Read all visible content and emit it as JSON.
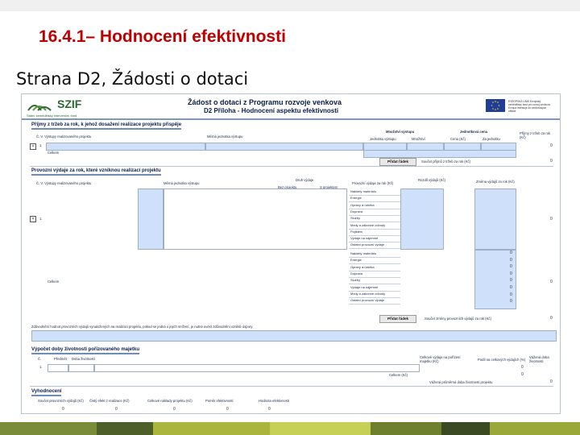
{
  "slide": {
    "title": "16.4.1– Hodnocení efektivnosti",
    "subtitle": "Strana D2, Žádosti o dotaci"
  },
  "form": {
    "logo_text": "SZIF",
    "logo_subtext": "Státní zemědělský intervenční fond",
    "title": "Žádost o dotaci z Programu rozvoje venkova",
    "subtitle": "D2 Příloha - Hodnocení aspektu efektivnosti",
    "eu_text": "EVROPSKÁ UNIE Evropský zemědělský fond pro rozvoj venkova: Evropa investuje do venkovských oblastí",
    "section1": {
      "heading": "Příjmy z tržeb za rok, k jehož dosažení realizace projektu přispěje",
      "col_item": "Č.  V. Výstupy realizovaného projektu",
      "col_measure": "Měrná jednotka výstupu",
      "col_amount": "Množství výstupu",
      "col_price": "Jednotková cena",
      "sub_unit": "Jednotka výstupu",
      "sub_qty": "Množství",
      "sub_unitprice": "Cena (Kč)",
      "sub_per": "Za jednotku",
      "col_revenue": "Příjmy z tržeb za rok (Kč)",
      "row_no": "1.",
      "total_label": "Celkem",
      "button": "Přidat řádek",
      "sum_label": "Součet příjmů z tržeb za rok (Kč)",
      "zero": "0"
    },
    "section2": {
      "heading": "Provozní výdaje za rok, které vzniknou realizací projektu",
      "col_item": "Č.  V. Výstupy realizovaného projektu",
      "col_measure": "Měrná jednotka výstupu",
      "col_kind": "Druh výdaje",
      "col_amount": "Provozní výdaje za rok (Kč)",
      "col_without": "Bez projektu",
      "col_with": "S projektem",
      "col_diff": "Rozdíl výdajů (Kč)",
      "col_change": "Změna výdajů za rok (Kč)",
      "row_no": "1.",
      "total_label": "Celkem",
      "costs": [
        "Náklady materiálu",
        "Energie",
        "Opravy a údržba",
        "Doprava",
        "Služby",
        "Mzdy a zákonné odvody",
        "Pojištění",
        "Výdaje na nájemné",
        "Ostatní provozní výdaje"
      ],
      "costs_total": [
        "Náklady materiálu",
        "Energie",
        "Opravy a údržba",
        "Doprava",
        "Služby",
        "Výdaje na nájemné",
        "Mzdy a zákonné odvody",
        "Ostatní provozní výdaje"
      ],
      "button": "Přidat řádek",
      "sum_label": "Součet změny provozních výdajů za rok (Kč)",
      "note": "Zdůvodnění hodnot provozních výdajů vynaložených na realizaci projektu, pokud se jedná o jejich snížení, je nutné uvést zdůvodnění vzniklé úspory"
    },
    "section3": {
      "heading": "Výpočet doby životnosti pořizovaného majetku",
      "col_no": "Č.",
      "col_item": "Předmět",
      "col_life": "Doba životnosti",
      "col_cost": "Celkové výdaje na pořízení majetku (Kč)",
      "col_share": "Podíl na celkových výdajích (%)",
      "col_weight": "Vážená doba životnosti",
      "row_no": "1.",
      "total_label": "Celkem (Kč)",
      "weighted_label": "Vážená průměrná doba životnosti projektu"
    },
    "section4": {
      "heading": "Vyhodnocení",
      "col_a": "Součet provozních výdajů (Kč)",
      "col_b": "Čistý efekt z realizace (Kč)",
      "col_c": "Celkové náklady projektu (Kč)",
      "col_d": "Poměr efektivnosti",
      "col_e": "Hodnota efektivnosti"
    }
  },
  "colors": {
    "title_red": "#c00000",
    "fill_blue": "#cfe0fb",
    "header_navy": "#0b1d4a",
    "szif_green": "#2a6a32",
    "footer": [
      "#7a8c3a",
      "#4f5f2a",
      "#a9b53c",
      "#c6cf56",
      "#6e7f2e",
      "#3b4a22",
      "#9aa83a"
    ]
  }
}
